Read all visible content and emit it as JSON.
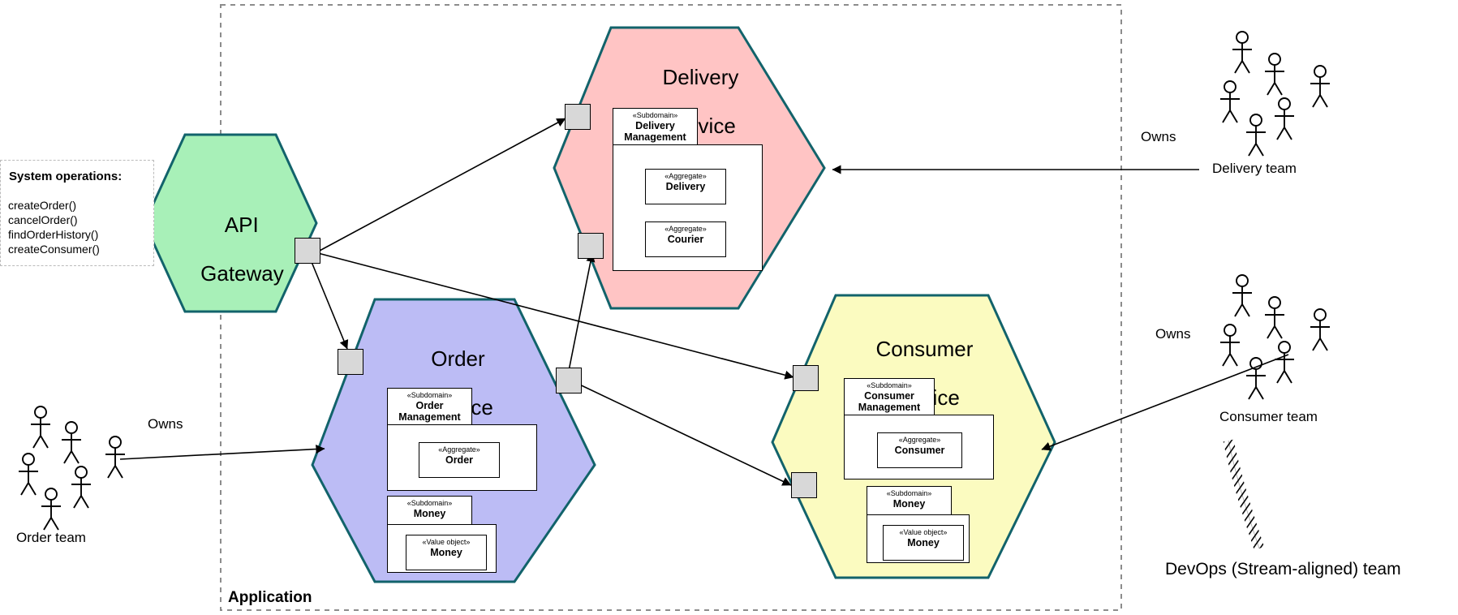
{
  "diagram": {
    "application_boundary_label": "Application",
    "system_operations": {
      "title": "System operations:",
      "operations": [
        "createOrder()",
        "cancelOrder()",
        "findOrderHistory()",
        "createConsumer()"
      ]
    },
    "services": [
      {
        "id": "api-gateway",
        "title_line1": "API",
        "title_line2": "Gateway",
        "fill": "#a8f0b8",
        "stroke": "#12636b",
        "subdomains": []
      },
      {
        "id": "delivery-service",
        "title_line1": "Delivery",
        "title_line2": "Service",
        "fill": "#ffc4c4",
        "stroke": "#12636b",
        "subdomains": [
          {
            "stereotype": "«Subdomain»",
            "name_line1": "Delivery",
            "name_line2": "Management",
            "children": [
              {
                "stereotype": "«Aggregate»",
                "name": "Delivery"
              },
              {
                "stereotype": "«Aggregate»",
                "name": "Courier"
              }
            ]
          }
        ]
      },
      {
        "id": "order-service",
        "title_line1": "Order",
        "title_line2": "Service",
        "fill": "#bcbcf5",
        "stroke": "#12636b",
        "subdomains": [
          {
            "stereotype": "«Subdomain»",
            "name_line1": "Order",
            "name_line2": "Management",
            "children": [
              {
                "stereotype": "«Aggregate»",
                "name": "Order"
              }
            ]
          },
          {
            "stereotype": "«Subdomain»",
            "name_line1": "Money",
            "name_line2": "",
            "children": [
              {
                "stereotype": "«Value object»",
                "name": "Money"
              }
            ]
          }
        ]
      },
      {
        "id": "consumer-service",
        "title_line1": "Consumer",
        "title_line2": "Service",
        "fill": "#fbfbc0",
        "stroke": "#12636b",
        "subdomains": [
          {
            "stereotype": "«Subdomain»",
            "name_line1": "Consumer",
            "name_line2": "Management",
            "children": [
              {
                "stereotype": "«Aggregate»",
                "name": "Consumer"
              }
            ]
          },
          {
            "stereotype": "«Subdomain»",
            "name_line1": "Money",
            "name_line2": "",
            "children": [
              {
                "stereotype": "«Value object»",
                "name": "Money"
              }
            ]
          }
        ]
      }
    ],
    "teams": [
      {
        "id": "order-team",
        "label": "Order team",
        "relation": "Owns"
      },
      {
        "id": "delivery-team",
        "label": "Delivery team",
        "relation": "Owns"
      },
      {
        "id": "consumer-team",
        "label": "Consumer team",
        "relation": "Owns"
      }
    ],
    "devops_label": "DevOps (Stream-aligned) team"
  }
}
